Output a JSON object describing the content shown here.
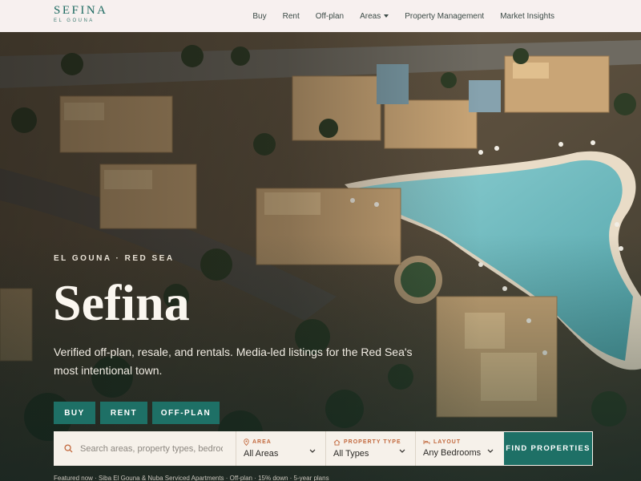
{
  "brand": {
    "name": "SEFINA",
    "tagline": "EL GOUNA"
  },
  "nav": {
    "items": [
      {
        "label": "Buy"
      },
      {
        "label": "Rent"
      },
      {
        "label": "Off-plan"
      },
      {
        "label": "Areas"
      },
      {
        "label": "Property Management"
      },
      {
        "label": "Market Insights"
      }
    ]
  },
  "hero": {
    "eyebrow": "EL GOUNA · RED SEA",
    "title": "Sefina",
    "subtitle": "Verified off-plan, resale, and rentals. Media-led listings for the Red Sea's most intentional town.",
    "buttons": {
      "buy": "BUY",
      "rent": "RENT",
      "offplan": "OFF-PLAN"
    }
  },
  "search": {
    "placeholder": "Search areas, property types, bedrooms",
    "filters": {
      "area": {
        "label": "AREA",
        "value": "All Areas",
        "icon": "map-pin-icon"
      },
      "type": {
        "label": "PROPERTY TYPE",
        "value": "All Types",
        "icon": "home-icon"
      },
      "layout": {
        "label": "LAYOUT",
        "value": "Any Bedrooms",
        "icon": "bed-icon"
      }
    },
    "submit": "FIND PROPERTIES"
  },
  "featured": "Featured now · Siba El Gouna & Nuba Serviced Apartments · Off-plan · 15% down · 5-year plans",
  "colors": {
    "accent": "#1e7066",
    "header_bg": "#f7f0ef",
    "label_orange": "#c2683d"
  }
}
